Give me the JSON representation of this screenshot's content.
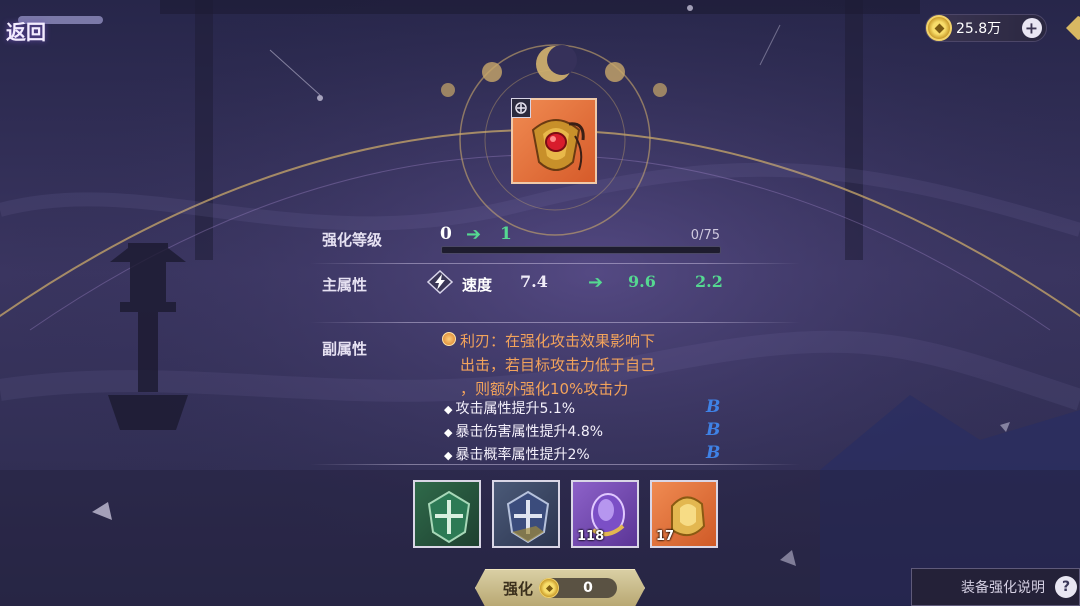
{
  "header": {
    "back_label": "返回",
    "currency": {
      "amount": "25.8万",
      "icon": "coin-icon",
      "add_label": "+"
    }
  },
  "equipment": {
    "icon": "equipment-gem-icon",
    "badge_icon": "set-badge-icon"
  },
  "enhance_level": {
    "label": "强化等级",
    "from": "0",
    "to": "1",
    "progress_text": "0/75",
    "progress": 0
  },
  "main_attribute": {
    "label": "主属性",
    "icon": "speed-icon",
    "name": "速度",
    "from": "7.4",
    "to": "9.6",
    "delta": "2.2"
  },
  "sub_attributes": {
    "label": "副属性",
    "skill": {
      "icon": "skill-icon",
      "lines": [
        "利刃：在强化攻击效果影响下",
        "出击，若目标攻击力低于自己",
        "，则额外强化10%攻击力"
      ]
    },
    "items": [
      {
        "text": "攻击属性提升5.1%",
        "grade": "B"
      },
      {
        "text": "暴击伤害属性提升4.8%",
        "grade": "B"
      },
      {
        "text": "暴击概率属性提升2%",
        "grade": "B"
      }
    ]
  },
  "materials": [
    {
      "name": "green-shield-material",
      "count": ""
    },
    {
      "name": "blue-shield-material",
      "count": ""
    },
    {
      "name": "purple-gem-material",
      "count": "118"
    },
    {
      "name": "gold-ore-material",
      "count": "17"
    }
  ],
  "footer": {
    "enhance_label": "强化",
    "cost": "0",
    "help_text": "装备强化说明",
    "help_icon": "?"
  },
  "colors": {
    "accent_green": "#55d891",
    "skill_orange": "#f3a35b",
    "grade_blue": "#3f82e6",
    "gold": "#f2d36b"
  }
}
